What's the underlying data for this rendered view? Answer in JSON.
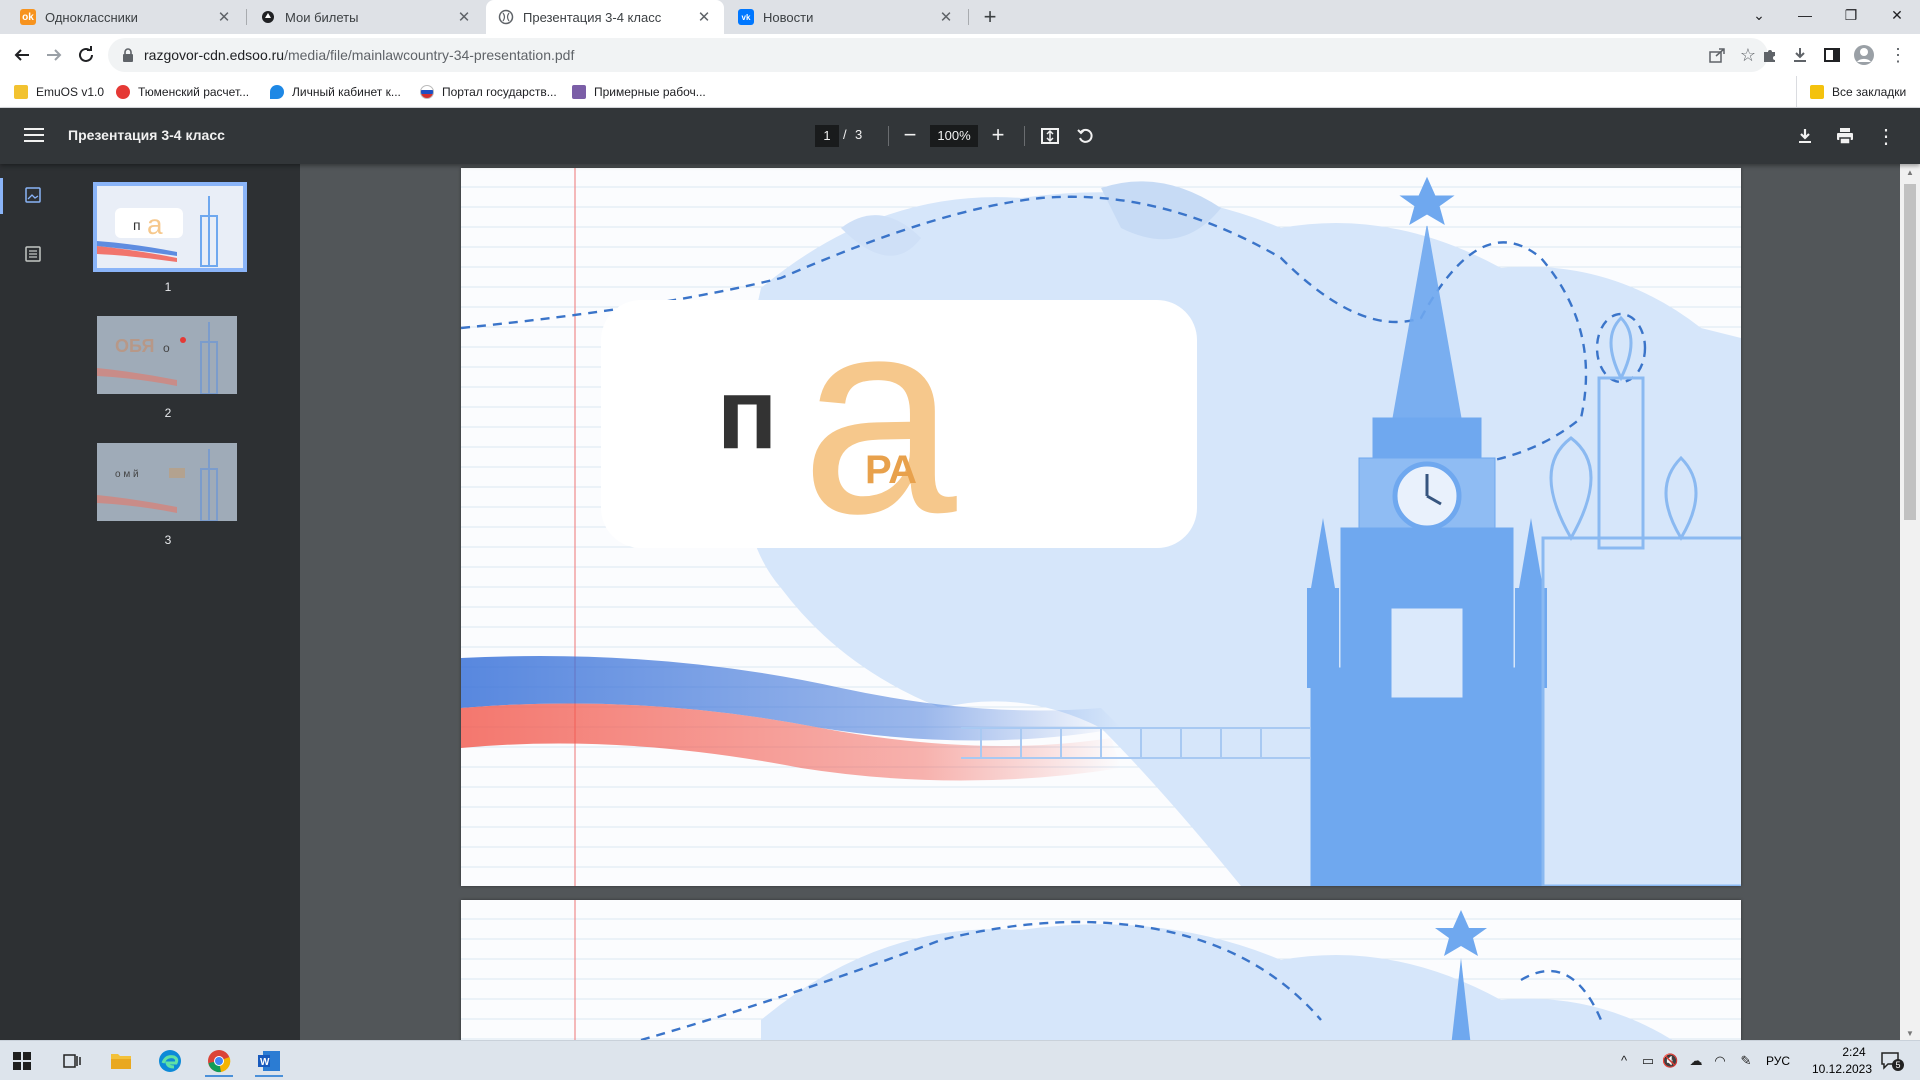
{
  "browser": {
    "tabs": [
      {
        "title": "Одноклассники",
        "favicon": "odnoklassniki-icon",
        "color": "#f7931e",
        "glyph": "ok"
      },
      {
        "title": "Мои билеты",
        "favicon": "ticket-site-icon",
        "color": "#202124",
        "glyph": "●"
      },
      {
        "title": "Презентация 3-4 класс",
        "favicon": "globe-icon",
        "color": "#5f6368",
        "glyph": "◎"
      },
      {
        "title": "Новости",
        "favicon": "vk-icon",
        "color": "#0077ff",
        "glyph": "vk"
      }
    ],
    "active_tab": 2,
    "new_tab": "+",
    "url_host": "razgovor-cdn.edsoo.ru",
    "url_path": "/media/file/mainlawcountry-34-presentation.pdf",
    "bookmarks": [
      {
        "label": "EmuOS v1.0",
        "icon": "emuos-icon",
        "color": "#f2c230"
      },
      {
        "label": "Тюменский расчет...",
        "icon": "tyumen-icon",
        "color": "#e53935"
      },
      {
        "label": "Личный кабинет к...",
        "icon": "gas-icon",
        "color": "#1e88e5"
      },
      {
        "label": "Портал государств...",
        "icon": "gosuslugi-icon",
        "color": "#d32f2f"
      },
      {
        "label": "Примерные рабоч...",
        "icon": "document-icon",
        "color": "#7b5ea7"
      }
    ],
    "all_bookmarks": "Все закладки"
  },
  "pdf": {
    "title": "Презентация 3-4 класс",
    "page_current": "1",
    "page_sep": "/",
    "page_total": "3",
    "zoom": "100%",
    "thumbnails": [
      {
        "num": "1",
        "selected": true
      },
      {
        "num": "2",
        "selected": false
      },
      {
        "num": "3",
        "selected": false
      }
    ],
    "slide": {
      "letter_dark": "п",
      "letter_big": "а",
      "inner_text": "РА"
    }
  },
  "taskbar": {
    "lang": "РУС",
    "time": "2:24",
    "date": "10.12.2023",
    "notifications": "5"
  },
  "colors": {
    "accent": "#8ab4f8",
    "pdf_bar": "#323639",
    "letter_orange": "#f6c88c",
    "flag_blue": "#3b73d9",
    "flag_red": "#f2564a",
    "kremlin_blue": "#6fa8ef"
  }
}
